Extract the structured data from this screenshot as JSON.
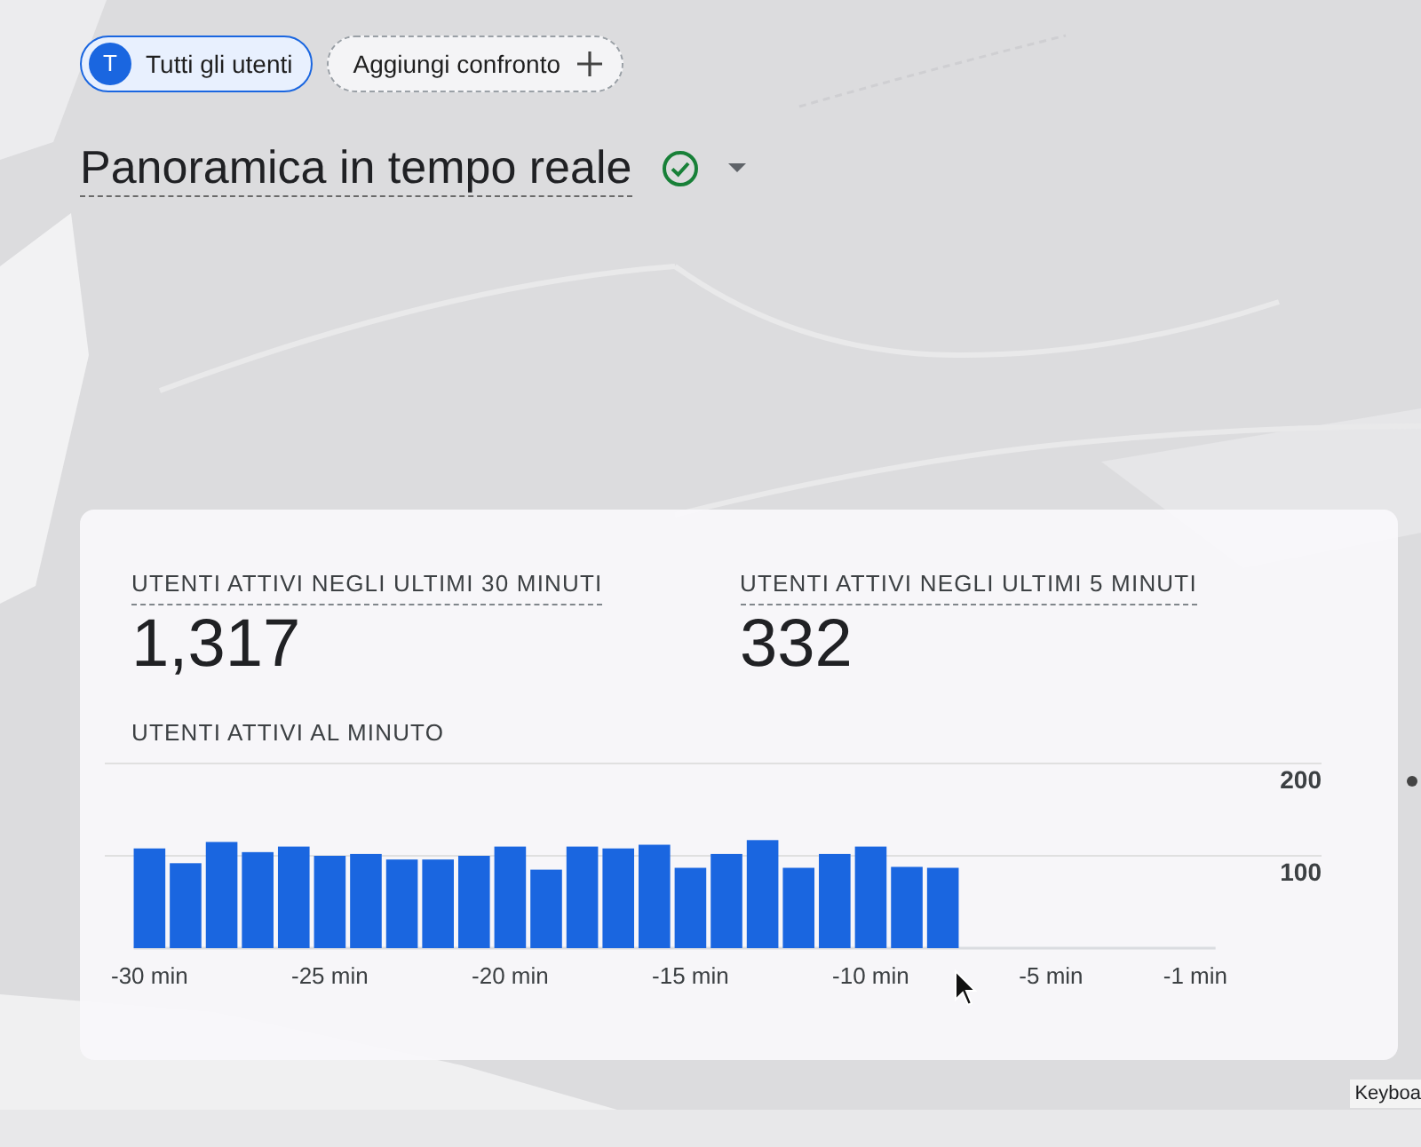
{
  "filters": [
    {
      "kind": "segment",
      "avatar": "T",
      "label": "Tutti gli utenti",
      "selected": true
    },
    {
      "kind": "add",
      "label": "Aggiungi confronto",
      "selected": false
    }
  ],
  "title": {
    "text": "Panoramica in tempo reale",
    "verified": true
  },
  "card": {
    "metrics": [
      {
        "label": "UTENTI ATTIVI NEGLI ULTIMI 30 MINUTI",
        "value": "1,317"
      },
      {
        "label": "UTENTI ATTIVI NEGLI ULTIMI 5 MINUTI",
        "value": "332"
      }
    ],
    "chart_title": "UTENTI ATTIVI AL MINUTO",
    "chart_data": {
      "type": "bar",
      "x": [
        -30,
        -29,
        -28,
        -27,
        -26,
        -25,
        -24,
        -23,
        -22,
        -21,
        -20,
        -19,
        -18,
        -17,
        -16,
        -15,
        -14,
        -13,
        -12,
        -11,
        -10,
        -9,
        -8,
        -7,
        -6,
        -5,
        -4,
        -3,
        -2,
        -1
      ],
      "series": [
        {
          "color": "#1a66e0",
          "values": [
            108,
            92,
            115,
            104,
            110,
            100,
            102,
            96,
            96,
            100,
            110,
            85,
            110,
            108,
            112,
            87,
            102,
            117,
            87,
            102,
            110,
            88,
            87,
            0,
            0,
            0,
            0,
            0,
            0,
            0
          ]
        }
      ],
      "xlim": [
        -31.24,
        2.5
      ],
      "ylim": [
        0,
        200
      ],
      "yticks": [
        100,
        200
      ],
      "xticks": [
        {
          "value": -30,
          "label": "-30 min"
        },
        {
          "value": -25,
          "label": "-25 min"
        },
        {
          "value": -20,
          "label": "-20 min"
        },
        {
          "value": -15,
          "label": "-15 min"
        },
        {
          "value": -10,
          "label": "-10 min"
        },
        {
          "value": -5,
          "label": "-5 min"
        },
        {
          "value": -1,
          "label": "-1 min"
        }
      ]
    }
  },
  "map_attribution": "Keyboa"
}
